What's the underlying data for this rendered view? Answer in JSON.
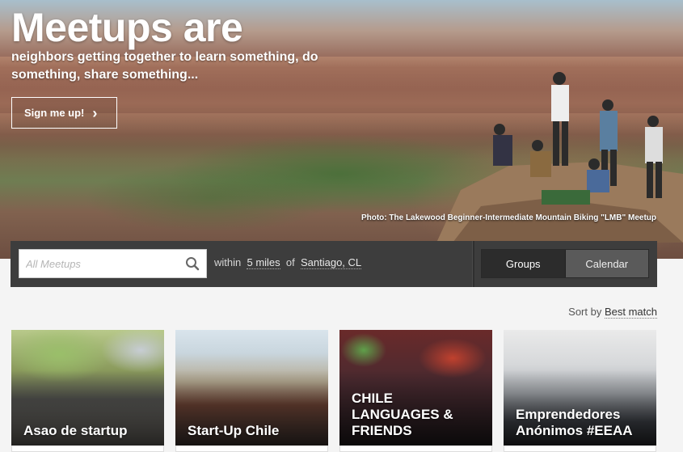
{
  "hero": {
    "title": "Meetups are",
    "subtitle": "neighbors getting together to learn something, do something, share something...",
    "signup_label": "Sign me up!",
    "photo_credit": "Photo: The Lakewood Beginner-Intermediate Mountain Biking \"LMB\" Meetup"
  },
  "search": {
    "placeholder": "All Meetups",
    "within_label": "within",
    "radius": "5 miles",
    "of_label": "of",
    "location": "Santiago, CL",
    "tabs": [
      "Groups",
      "Calendar"
    ]
  },
  "sort": {
    "label": "Sort by",
    "value": "Best match"
  },
  "groups": [
    {
      "name": "Asao de startup"
    },
    {
      "name": "Start-Up Chile"
    },
    {
      "name": "CHILE LANGUAGES & FRIENDS"
    },
    {
      "name": "Emprendedores Anónimos #EEAA"
    }
  ]
}
